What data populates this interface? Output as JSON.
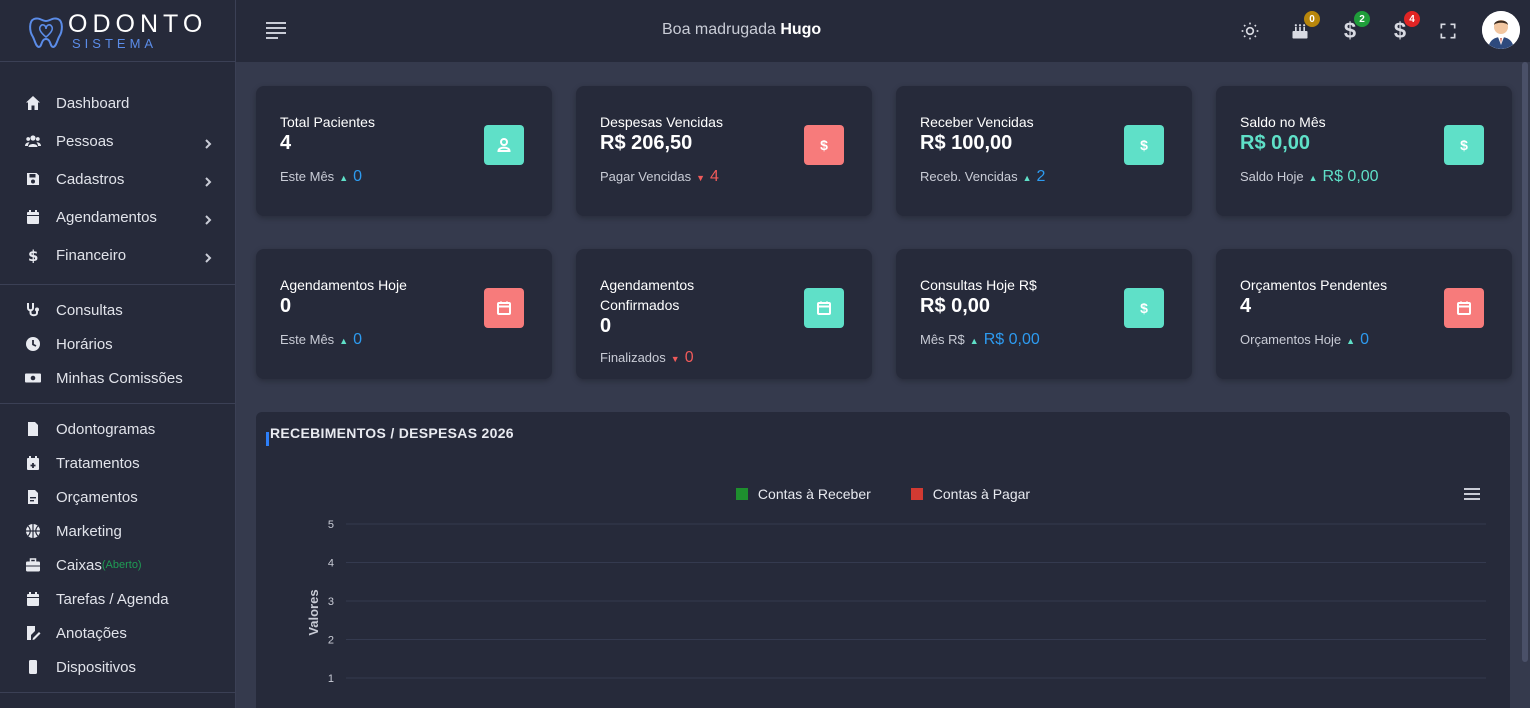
{
  "app": {
    "brand_top": "ODONTO",
    "brand_bottom": "SISTEMA"
  },
  "sidebar": {
    "groups": [
      [
        {
          "label": "Dashboard",
          "icon": "home-icon"
        },
        {
          "label": "Pessoas",
          "icon": "users-icon",
          "has_children": true
        },
        {
          "label": "Cadastros",
          "icon": "save-icon",
          "has_children": true
        },
        {
          "label": "Agendamentos",
          "icon": "calendar-icon",
          "has_children": true
        },
        {
          "label": "Financeiro",
          "icon": "dollar-icon",
          "has_children": true
        }
      ],
      [
        {
          "label": "Consultas",
          "icon": "stethoscope-icon"
        },
        {
          "label": "Horários",
          "icon": "clock-icon"
        },
        {
          "label": "Minhas Comissões",
          "icon": "money-icon"
        }
      ],
      [
        {
          "label": "Odontogramas",
          "icon": "file-icon"
        },
        {
          "label": "Tratamentos",
          "icon": "calendar-plus-icon"
        },
        {
          "label": "Orçamentos",
          "icon": "file-invoice-icon"
        },
        {
          "label": "Marketing",
          "icon": "basketball-icon"
        },
        {
          "label": "Caixas",
          "icon": "briefcase-icon",
          "suffix": "(Aberto)"
        },
        {
          "label": "Tarefas / Agenda",
          "icon": "calendar-icon"
        },
        {
          "label": "Anotações",
          "icon": "edit-note-icon"
        },
        {
          "label": "Dispositivos",
          "icon": "mobile-icon"
        }
      ]
    ]
  },
  "topbar": {
    "greeting_prefix": "Boa madrugada",
    "greeting_name": "Hugo",
    "badges": {
      "birthday": "0",
      "receivables": "2",
      "payables": "4"
    },
    "badge_colors": {
      "birthday": "#b8860b",
      "receivables": "#1f9d3a",
      "payables": "#e02424"
    }
  },
  "cards": [
    {
      "title": "Total Pacientes",
      "value": "4",
      "sub_label": "Este Mês",
      "sub_value": "0",
      "trend": "up",
      "icon": "user-icon",
      "icon_bg": "#5fe0c8",
      "value_color": "#ffffff",
      "num_color": "#2d9bf0"
    },
    {
      "title": "Despesas Vencidas",
      "value": "R$ 206,50",
      "sub_label": "Pagar Vencidas",
      "sub_value": "4",
      "trend": "down",
      "icon": "dollar-icon",
      "icon_bg": "#f77b7b",
      "value_color": "#ffffff",
      "num_color": "#f05a5a"
    },
    {
      "title": "Receber Vencidas",
      "value": "R$ 100,00",
      "sub_label": "Receb. Vencidas",
      "sub_value": "2",
      "trend": "up",
      "icon": "dollar-icon",
      "icon_bg": "#5fe0c8",
      "value_color": "#ffffff",
      "num_color": "#2d9bf0"
    },
    {
      "title": "Saldo no Mês",
      "value": "R$ 0,00",
      "sub_label": "Saldo Hoje",
      "sub_value": "R$ 0,00",
      "trend": "up",
      "icon": "dollar-icon",
      "icon_bg": "#5fe0c8",
      "value_color": "#5fe0c8",
      "num_color": "#5fe0c8"
    },
    {
      "title": "Agendamentos Hoje",
      "value": "0",
      "sub_label": "Este Mês",
      "sub_value": "0",
      "trend": "up",
      "icon": "calendar-icon",
      "icon_bg": "#f77b7b",
      "value_color": "#ffffff",
      "num_color": "#2d9bf0"
    },
    {
      "title": "Agendamentos Confirmados",
      "value": "0",
      "sub_label": "Finalizados",
      "sub_value": "0",
      "trend": "down",
      "icon": "calendar-icon",
      "icon_bg": "#5fe0c8",
      "value_color": "#ffffff",
      "num_color": "#f05a5a"
    },
    {
      "title": "Consultas Hoje R$",
      "value": "R$ 0,00",
      "sub_label": "Mês R$",
      "sub_value": "R$ 0,00",
      "trend": "up",
      "icon": "dollar-icon",
      "icon_bg": "#5fe0c8",
      "value_color": "#ffffff",
      "num_color": "#2d9bf0"
    },
    {
      "title": "Orçamentos Pendentes",
      "value": "4",
      "sub_label": "Orçamentos Hoje",
      "sub_value": "0",
      "trend": "up",
      "icon": "calendar-icon",
      "icon_bg": "#f77b7b",
      "value_color": "#ffffff",
      "num_color": "#2d9bf0"
    }
  ],
  "chart_panel": {
    "title": "RECEBIMENTOS / DESPESAS 2026"
  },
  "chart_data": {
    "type": "bar",
    "title": "",
    "xlabel": "",
    "ylabel": "Valores",
    "ylim": [
      0,
      5
    ],
    "yticks": [
      "1",
      "2",
      "3",
      "4",
      "5"
    ],
    "legend_position": "top-center",
    "series": [
      {
        "name": "Contas à Receber",
        "color": "#1e8f2e",
        "values": []
      },
      {
        "name": "Contas à Pagar",
        "color": "#d23a32",
        "values": []
      }
    ],
    "grid": true
  }
}
